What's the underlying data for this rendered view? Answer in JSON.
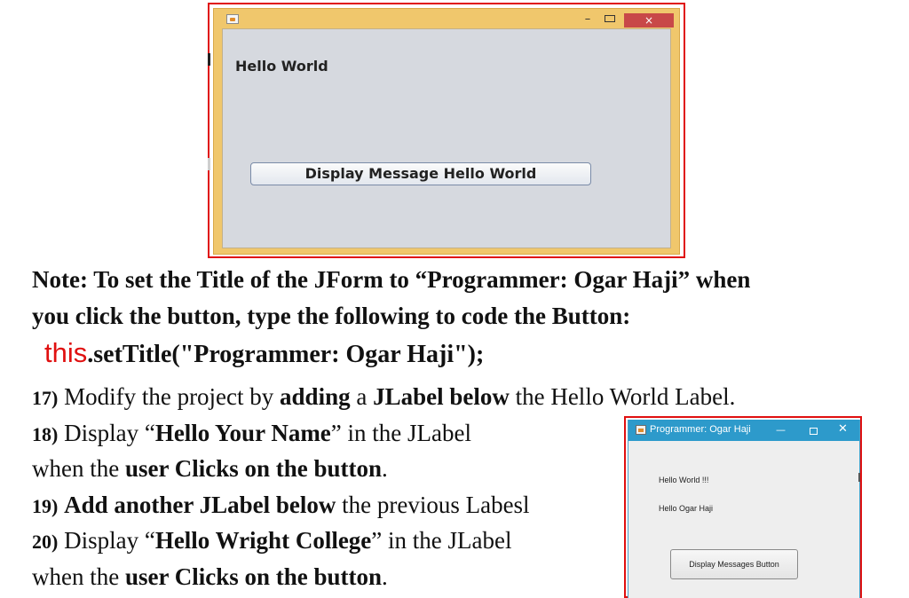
{
  "window1": {
    "minimize_glyph": "–",
    "close_glyph": "×",
    "label": "Hello World",
    "button_label": "Display Message Hello World"
  },
  "note": {
    "line1": "Note: To set the Title of the JForm to “Programmer: Ogar Haji” when",
    "line2": "you click the button, type the following to code the Button:"
  },
  "code": {
    "keyword": "this",
    "rest": ".setTitle(\"Programmer: Ogar Haji\");"
  },
  "steps": {
    "s17": {
      "num": "17)",
      "a": " Modify the project by ",
      "b": "adding",
      "c": " a ",
      "d": "JLabel below",
      "e": " the Hello World Label."
    },
    "s18": {
      "num": "18)",
      "a": " Display “",
      "b": "Hello Your Name",
      "c": "” in the JLabel"
    },
    "s18b": {
      "a": "when the ",
      "b": "user Clicks on the button",
      "c": "."
    },
    "s19": {
      "num": "19)",
      "a": " ",
      "b": "Add another JLabel below",
      "c": " the previous Labesl"
    },
    "s20": {
      "num": "20)",
      "a": " Display “",
      "b": "Hello Wright College",
      "c": "” in the JLabel"
    },
    "s20b": {
      "a": "when the ",
      "b": "user Clicks on the button",
      "c": "."
    }
  },
  "window2": {
    "title": "Programmer: Ogar Haji",
    "minimize_glyph": "—",
    "close_glyph": "✕",
    "label1": "Hello World !!!",
    "label2": "Hello Ogar Haji",
    "button_label": "Display Messages Button",
    "titlebar_color": "#2d9acb"
  }
}
